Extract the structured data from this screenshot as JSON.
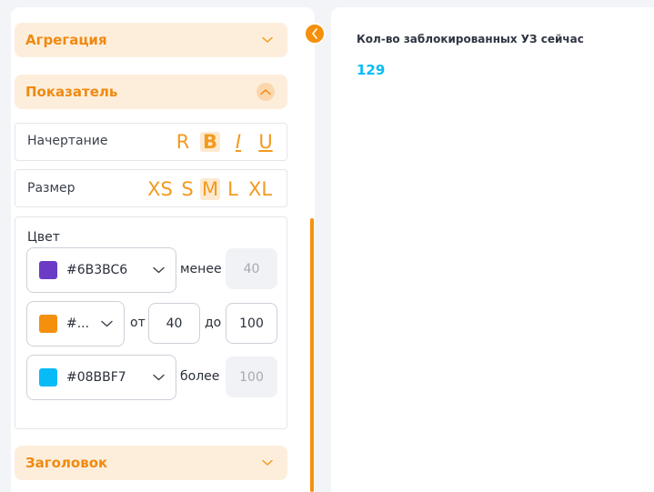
{
  "sections": {
    "aggregation": {
      "title": "Агрегация"
    },
    "indicator": {
      "title": "Показатель"
    },
    "header": {
      "title": "Заголовок"
    }
  },
  "style_row": {
    "label": "Начертание",
    "options": [
      {
        "label": "R",
        "active": false
      },
      {
        "label": "B",
        "active": true
      },
      {
        "label": "I",
        "active": false
      },
      {
        "label": "U",
        "active": false
      }
    ]
  },
  "size_row": {
    "label": "Размер",
    "options": [
      {
        "label": "XS",
        "active": false
      },
      {
        "label": "S",
        "active": false
      },
      {
        "label": "M",
        "active": true
      },
      {
        "label": "L",
        "active": false
      },
      {
        "label": "XL",
        "active": false
      }
    ]
  },
  "color_block": {
    "label": "Цвет",
    "rules": [
      {
        "color": "#6B3BC6",
        "select_text": "#6B3BC6",
        "condition_label": "менее",
        "value": "40"
      },
      {
        "color": "#F5900C",
        "select_text": "#...",
        "from_label": "от",
        "from_value": "40",
        "to_label": "до",
        "to_value": "100"
      },
      {
        "color": "#08BBF7",
        "select_text": "#08BBF7",
        "condition_label": "более",
        "value": "100"
      }
    ]
  },
  "metric": {
    "title": "Кол-во заблокированных УЗ сейчас",
    "value": "129"
  },
  "colors": {
    "accent": "#F5900C",
    "accent_text": "#EF8A10",
    "header_bg": "#FDEEDC",
    "value_color": "#08BBF7"
  }
}
